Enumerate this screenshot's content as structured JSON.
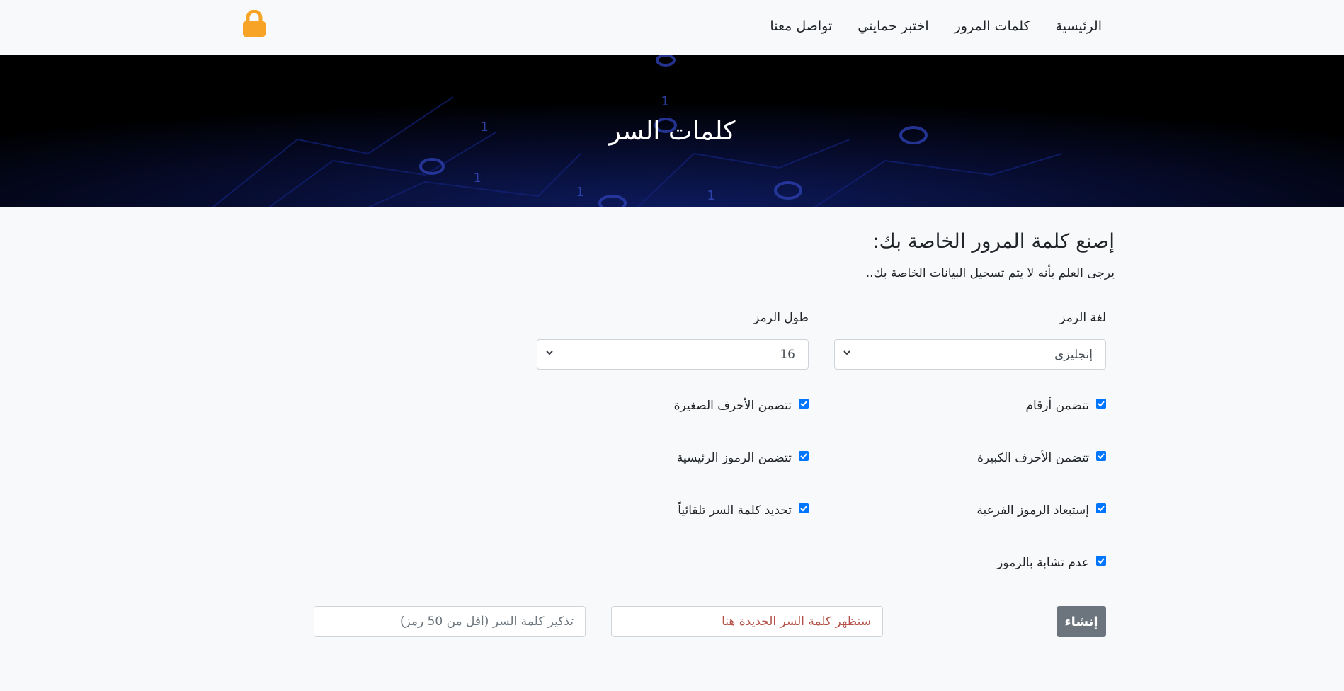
{
  "navbar": {
    "brand_icon": "lock-icon",
    "brand_color": "#f7a325",
    "links": [
      {
        "label": "الرئيسية"
      },
      {
        "label": "كلمات المرور"
      },
      {
        "label": "اختبر حمايتي"
      },
      {
        "label": "تواصل معنا"
      }
    ]
  },
  "hero": {
    "title": "كلمات السر",
    "background": "dark binary digits (0/1) on blue circuit-like pattern"
  },
  "form": {
    "heading": "إصنع كلمة المرور الخاصة بك:",
    "note": "يرجى العلم بأنه لا يتم تسجيل البيانات الخاصة بك..",
    "language": {
      "label": "لغة الرمز",
      "value": "إنجليزى"
    },
    "length": {
      "label": "طول الرمز",
      "value": "16"
    },
    "options": [
      {
        "label": "تتضمن أرقام",
        "checked": true
      },
      {
        "label": "تتضمن الأحرف الصغيرة",
        "checked": true
      },
      {
        "label": "تتضمن الأحرف الكبيرة",
        "checked": true
      },
      {
        "label": "تتضمن الرموز الرئيسية",
        "checked": true
      },
      {
        "label": "إستبعاد الرموز الفرعية",
        "checked": true
      },
      {
        "label": "تحديد كلمة السر تلقائياً",
        "checked": true
      },
      {
        "label": "عدم تشابة بالرموز",
        "checked": true
      }
    ],
    "create_button": "إنشاء",
    "output_placeholder": "ستظهر كلمة السر الجديدة هنا",
    "remember_placeholder": "تذكير كلمة السر (أقل من 50 رمز)"
  },
  "colors": {
    "accent_checkbox": "#0075ff",
    "button": "#6c757d",
    "output_text": "#b5534a"
  }
}
